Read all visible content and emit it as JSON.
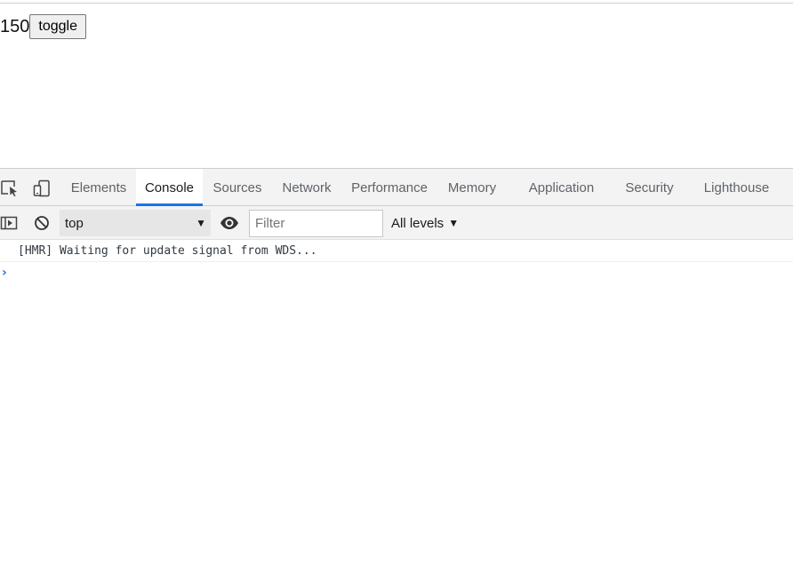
{
  "app": {
    "counter_value": "150",
    "toggle_label": "toggle"
  },
  "devtools": {
    "toolbar_icons": {
      "inspect": "inspect-element-icon",
      "device": "device-toolbar-icon"
    },
    "tabs": [
      {
        "label": "Elements",
        "active": false
      },
      {
        "label": "Console",
        "active": true
      },
      {
        "label": "Sources",
        "active": false
      },
      {
        "label": "Network",
        "active": false
      },
      {
        "label": "Performance",
        "active": false
      },
      {
        "label": "Memory",
        "active": false
      },
      {
        "label": "Application",
        "active": false
      },
      {
        "label": "Security",
        "active": false
      },
      {
        "label": "Lighthouse",
        "active": false
      }
    ],
    "console_toolbar": {
      "sidebar_icon": "show-sidebar-icon",
      "clear_icon": "clear-console-icon",
      "context_value": "top",
      "eye_icon": "live-expression-eye-icon",
      "filter_placeholder": "Filter",
      "levels_label": "All levels"
    },
    "messages": [
      {
        "text": "[HMR] Waiting for update signal from WDS..."
      }
    ],
    "accent_color": "#1a73e8"
  }
}
